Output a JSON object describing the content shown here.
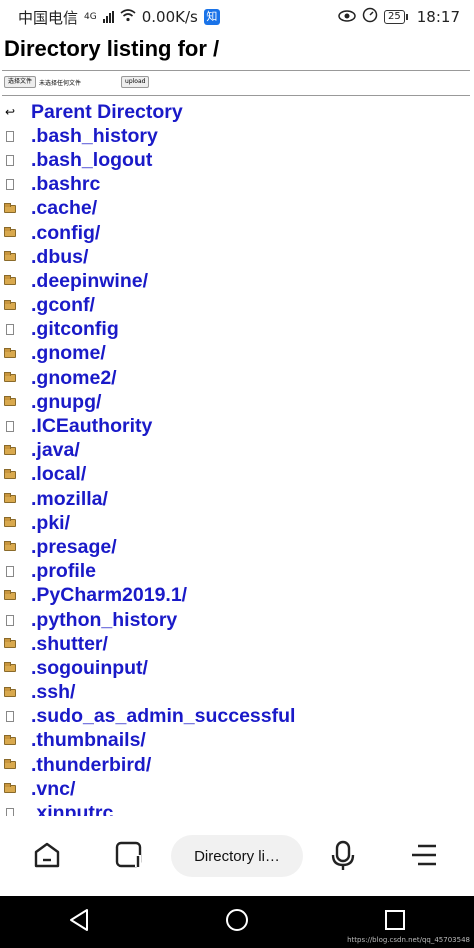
{
  "status_bar": {
    "carrier": "中国电信",
    "network": "4G",
    "speed": "0.00K/s",
    "app_badge": "知",
    "battery": "25",
    "time": "18:17",
    "icons": [
      "eye-icon",
      "speedometer-icon"
    ]
  },
  "page": {
    "title": "Directory listing for /",
    "upload": {
      "choose_label": "选择文件",
      "no_file_text": "未选择任何文件",
      "upload_label": "upload"
    },
    "entries": [
      {
        "name": "Parent Directory",
        "type": "parent"
      },
      {
        "name": ".bash_history",
        "type": "file"
      },
      {
        "name": ".bash_logout",
        "type": "file"
      },
      {
        "name": ".bashrc",
        "type": "file"
      },
      {
        "name": ".cache/",
        "type": "folder"
      },
      {
        "name": ".config/",
        "type": "folder"
      },
      {
        "name": ".dbus/",
        "type": "folder"
      },
      {
        "name": ".deepinwine/",
        "type": "folder"
      },
      {
        "name": ".gconf/",
        "type": "folder"
      },
      {
        "name": ".gitconfig",
        "type": "file"
      },
      {
        "name": ".gnome/",
        "type": "folder"
      },
      {
        "name": ".gnome2/",
        "type": "folder"
      },
      {
        "name": ".gnupg/",
        "type": "folder"
      },
      {
        "name": ".ICEauthority",
        "type": "file"
      },
      {
        "name": ".java/",
        "type": "folder"
      },
      {
        "name": ".local/",
        "type": "folder"
      },
      {
        "name": ".mozilla/",
        "type": "folder"
      },
      {
        "name": ".pki/",
        "type": "folder"
      },
      {
        "name": ".presage/",
        "type": "folder"
      },
      {
        "name": ".profile",
        "type": "file"
      },
      {
        "name": ".PyCharm2019.1/",
        "type": "folder"
      },
      {
        "name": ".python_history",
        "type": "file"
      },
      {
        "name": ".shutter/",
        "type": "folder"
      },
      {
        "name": ".sogouinput/",
        "type": "folder"
      },
      {
        "name": ".ssh/",
        "type": "folder"
      },
      {
        "name": ".sudo_as_admin_successful",
        "type": "file"
      },
      {
        "name": ".thumbnails/",
        "type": "folder"
      },
      {
        "name": ".thunderbird/",
        "type": "folder"
      },
      {
        "name": ".vnc/",
        "type": "folder"
      },
      {
        "name": ".xinputrc",
        "type": "file"
      }
    ]
  },
  "browser_bar": {
    "tab_title": "Directory li…",
    "icons": [
      "home-icon",
      "tabs-icon",
      "microphone-icon",
      "menu-icon"
    ]
  },
  "system_nav": {
    "icons": [
      "back-icon",
      "home-circle-icon",
      "recents-icon"
    ]
  },
  "watermark": "https://blog.csdn.net/qq_45703548",
  "colors": {
    "link": "#1a1ac8",
    "folder": "#d9a94e"
  }
}
